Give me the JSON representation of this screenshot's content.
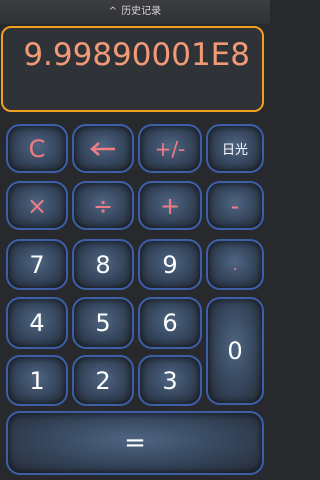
{
  "history": {
    "label": "历史记录",
    "icon": "chevron-up-icon"
  },
  "display": {
    "value": "9.99890001E8"
  },
  "keys": {
    "clear": "C",
    "backspace_icon": "left-arrow-icon",
    "sign": "+/-",
    "theme": "日光",
    "multiply": "×",
    "divide": "÷",
    "add": "+",
    "subtract": "-",
    "seven": "7",
    "eight": "8",
    "nine": "9",
    "dot": ".",
    "four": "4",
    "five": "5",
    "six": "6",
    "zero": "0",
    "one": "1",
    "two": "2",
    "three": "3",
    "equals": "="
  },
  "colors": {
    "accent": "#f0a020",
    "operator": "#f27c86",
    "key_border": "#3c5fa8",
    "background": "#27292d"
  }
}
